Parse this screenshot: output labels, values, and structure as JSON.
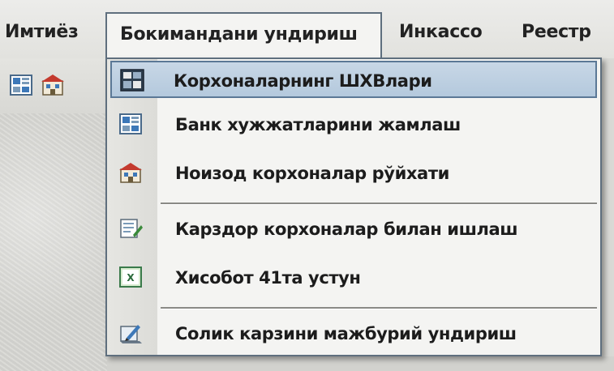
{
  "menubar": {
    "items": [
      {
        "label": "Имтиёз"
      },
      {
        "label": "Бокимандани ундириш"
      },
      {
        "label": "Инкассо"
      },
      {
        "label": "Реестр"
      }
    ]
  },
  "toolbar": {
    "buttons": [
      {
        "icon": "document-grid-icon"
      },
      {
        "icon": "building-list-icon"
      }
    ]
  },
  "dropdown": {
    "items": [
      {
        "label": "Корхоналарнинг ШХВлари",
        "icon": "table-grid-icon",
        "highlighted": true
      },
      {
        "label": "Банк хужжатларини жамлаш",
        "icon": "document-grid-icon"
      },
      {
        "label": "Ноизод корхоналар рўйхати",
        "icon": "building-list-icon"
      },
      {
        "label": "Карздор корхоналар билан ишлаш",
        "icon": "edit-document-icon"
      },
      {
        "label": "Хисобот 41та устун",
        "icon": "spreadsheet-icon"
      },
      {
        "label": "Солик карзини мажбурий ундириш",
        "icon": "pencil-sheet-icon"
      }
    ]
  },
  "colors": {
    "highlight": "#b4c9dd",
    "border": "#5f6f7e",
    "menu_bg": "#f4f4f2"
  }
}
